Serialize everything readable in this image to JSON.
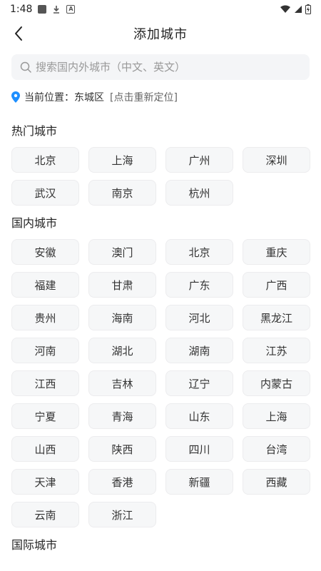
{
  "status_bar": {
    "time": "1:48"
  },
  "header": {
    "title": "添加城市"
  },
  "search": {
    "placeholder": "搜索国内外城市（中文、英文）"
  },
  "location": {
    "label": "当前位置：",
    "city": "东城区",
    "relocate": "[点击重新定位]"
  },
  "hot": {
    "title": "热门城市",
    "cities": [
      "北京",
      "上海",
      "广州",
      "深圳",
      "武汉",
      "南京",
      "杭州"
    ]
  },
  "domestic": {
    "title": "国内城市",
    "cities": [
      "安徽",
      "澳门",
      "北京",
      "重庆",
      "福建",
      "甘肃",
      "广东",
      "广西",
      "贵州",
      "海南",
      "河北",
      "黑龙江",
      "河南",
      "湖北",
      "湖南",
      "江苏",
      "江西",
      "吉林",
      "辽宁",
      "内蒙古",
      "宁夏",
      "青海",
      "山东",
      "上海",
      "山西",
      "陕西",
      "四川",
      "台湾",
      "天津",
      "香港",
      "新疆",
      "西藏",
      "云南",
      "浙江"
    ]
  },
  "international": {
    "title": "国际城市"
  },
  "colors": {
    "location_pin": "#1e8fff"
  }
}
